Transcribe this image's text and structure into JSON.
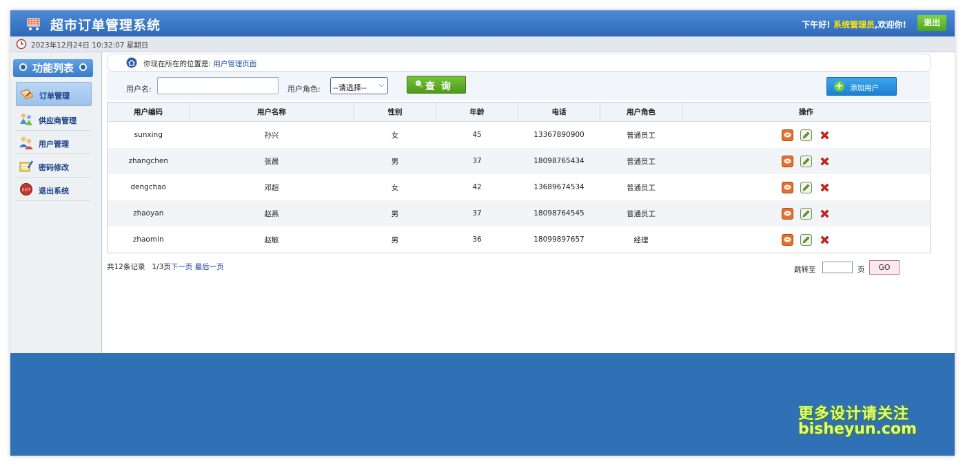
{
  "header": {
    "title": "超市订单管理系统",
    "greeting_prefix": "下午好!",
    "username": "系统管理员",
    "greeting_suffix": ",欢迎你!",
    "logout_label": "退出"
  },
  "timebar": {
    "datetime": "2023年12月24日 10:32:07 星期日"
  },
  "sidebar": {
    "title": "功能列表",
    "items": [
      {
        "label": "订单管理",
        "icon": "order-icon",
        "active": true
      },
      {
        "label": "供应商管理",
        "icon": "supplier-icon",
        "active": false
      },
      {
        "label": "用户管理",
        "icon": "users-icon",
        "active": false
      },
      {
        "label": "密码修改",
        "icon": "password-icon",
        "active": false
      },
      {
        "label": "退出系统",
        "icon": "exit-icon",
        "active": false
      }
    ]
  },
  "location": {
    "prefix": "你现在所在的位置是:",
    "page": "用户管理页面"
  },
  "search": {
    "username_label": "用户名:",
    "username_value": "",
    "role_label": "用户角色:",
    "role_selected": "--请选择--",
    "query_label": "查 询",
    "add_label": "添加用户"
  },
  "table": {
    "headers": [
      "用户编码",
      "用户名称",
      "性别",
      "年龄",
      "电话",
      "用户角色",
      "操作"
    ],
    "rows": [
      [
        "sunxing",
        "孙兴",
        "女",
        "45",
        "13367890900",
        "普通员工"
      ],
      [
        "zhangchen",
        "张晨",
        "男",
        "37",
        "18098765434",
        "普通员工"
      ],
      [
        "dengchao",
        "邓超",
        "女",
        "42",
        "13689674534",
        "普通员工"
      ],
      [
        "zhaoyan",
        "赵燕",
        "男",
        "37",
        "18098764545",
        "普通员工"
      ],
      [
        "zhaomin",
        "赵敏",
        "男",
        "36",
        "18099897657",
        "经理"
      ]
    ]
  },
  "pager": {
    "total": "共12条记录",
    "page": "1/3页",
    "next": "下一页",
    "last": "最后一页",
    "jump_label": "跳转至",
    "jump_value": "",
    "page_unit": "页",
    "go_label": "GO"
  },
  "watermark": {
    "line1": "更多设计请关注",
    "line2": "bisheyun.com"
  },
  "colors": {
    "header": "#3a78c6",
    "footer": "#3070b4",
    "accent_green": "#5fae24",
    "accent_blue": "#2a8ae0",
    "username": "#ffe600"
  }
}
